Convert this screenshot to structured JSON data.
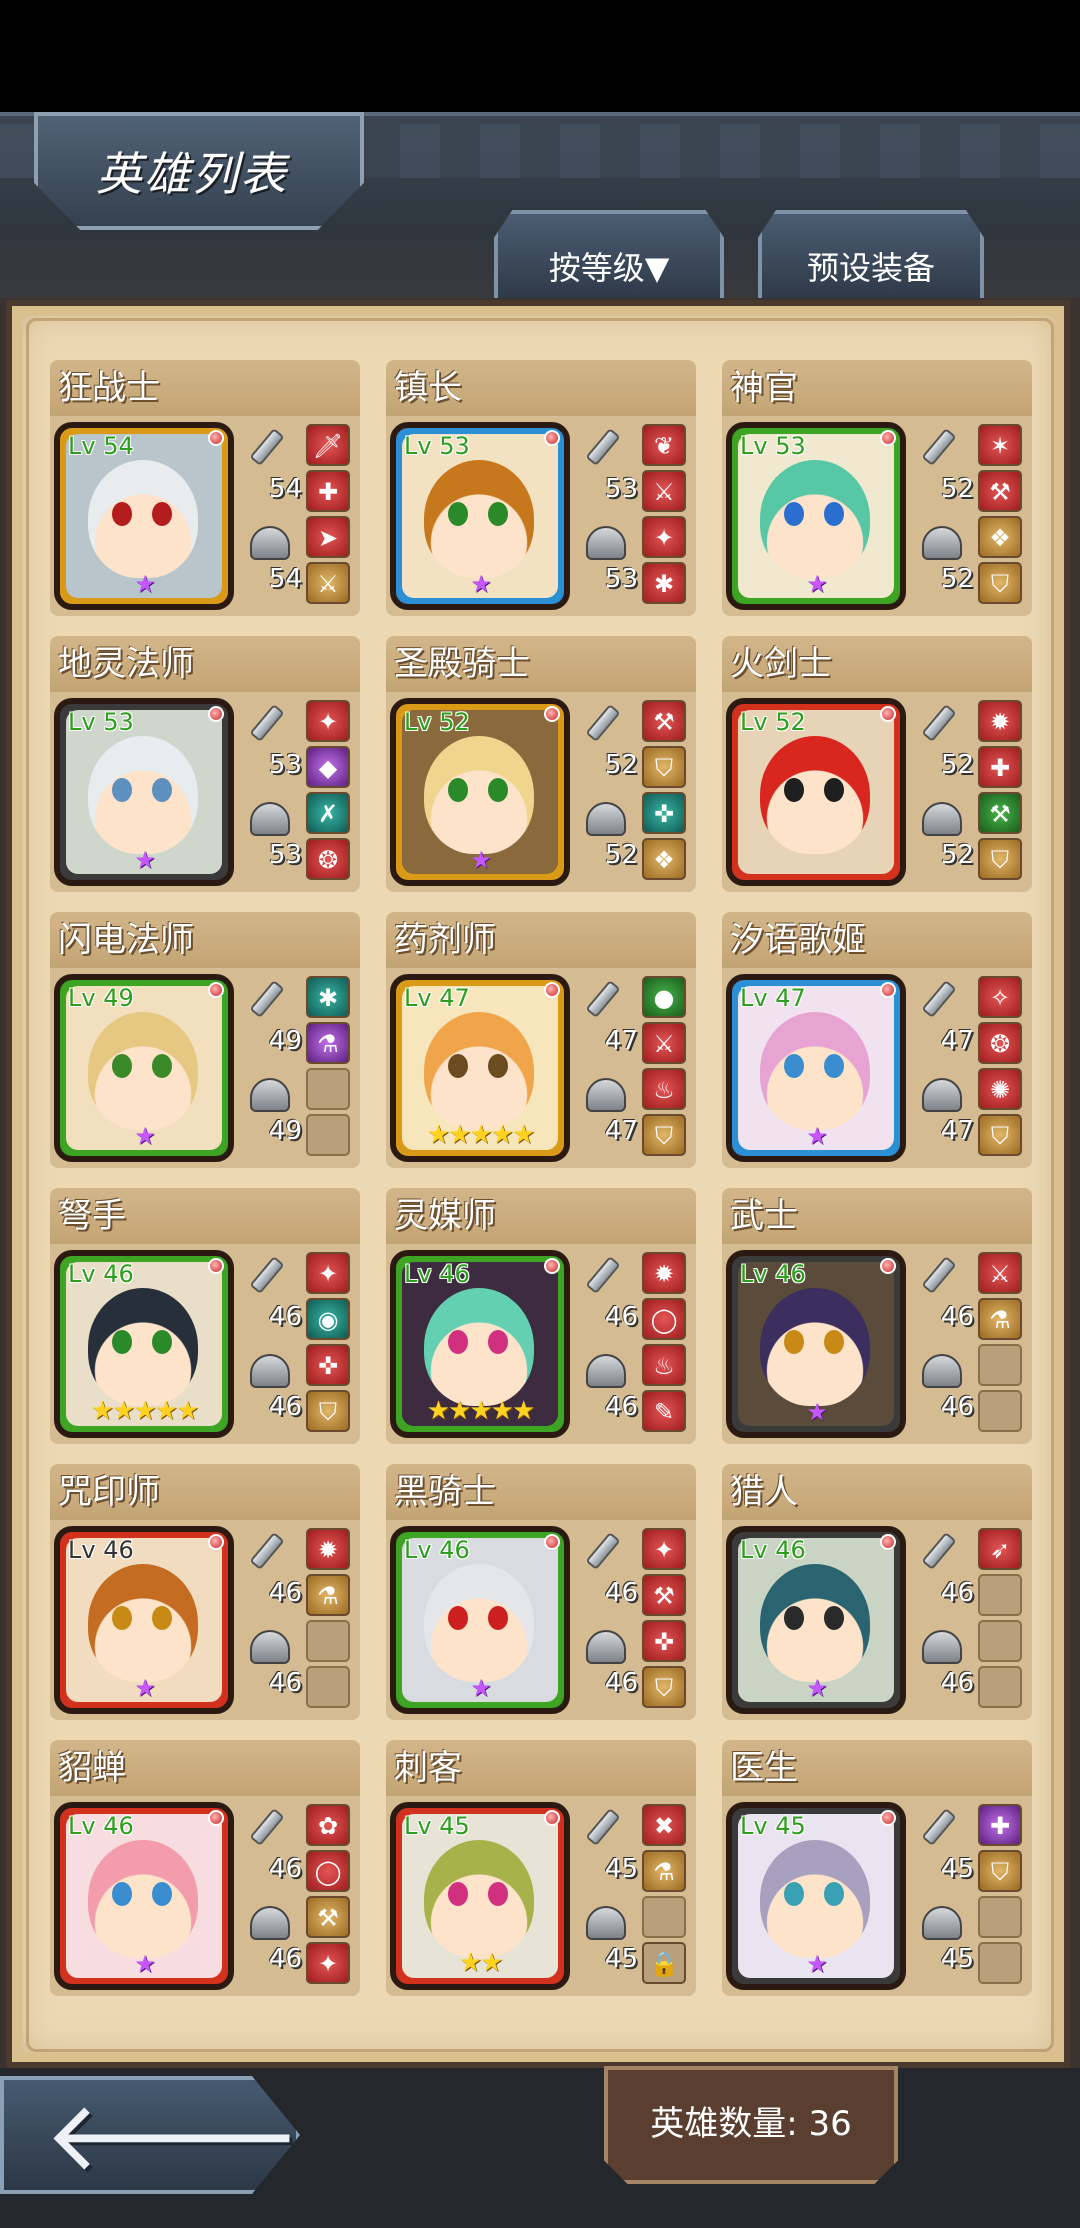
{
  "header": {
    "title": "英雄列表",
    "sort_label": "按等级▼",
    "preset_label": "预设装备"
  },
  "footer": {
    "hero_count_label": "英雄数量: 36"
  },
  "heroes": [
    {
      "name": "狂战士",
      "level": "Lv 54",
      "atk": "54",
      "def": "54",
      "frame": "#d99a17",
      "bg": "#b8c6cc",
      "hair": "#e9ecef",
      "eye": "#b31d1d",
      "stars": "★",
      "star_type": "purple",
      "slots": [
        "red",
        "red",
        "red",
        "gold"
      ],
      "slot_icons": [
        "🗡",
        "✚",
        "➤",
        "⚔"
      ]
    },
    {
      "name": "镇长",
      "level": "Lv 53",
      "atk": "53",
      "def": "53",
      "frame": "#2b8fd6",
      "bg": "#f2e2c2",
      "hair": "#c8781c",
      "eye": "#2a8a2a",
      "stars": "★",
      "star_type": "purple",
      "slots": [
        "red",
        "red",
        "red",
        "red"
      ],
      "slot_icons": [
        "❦",
        "⚔",
        "✦",
        "✱"
      ]
    },
    {
      "name": "神官",
      "level": "Lv 53",
      "atk": "52",
      "def": "52",
      "frame": "#3da424",
      "bg": "#f0e8cf",
      "hair": "#57c7a5",
      "eye": "#2a6fd0",
      "stars": "★",
      "star_type": "purple",
      "slots": [
        "red",
        "red",
        "gold",
        "gold"
      ],
      "slot_icons": [
        "✶",
        "⚒",
        "❖",
        "⛉"
      ]
    },
    {
      "name": "地灵法师",
      "level": "Lv 53",
      "atk": "53",
      "def": "53",
      "frame": "#3a3a3a",
      "bg": "#cfd6cc",
      "hair": "#e7ecef",
      "eye": "#5e90bf",
      "stars": "★",
      "star_type": "purple",
      "slots": [
        "red",
        "purple",
        "teal",
        "red"
      ],
      "slot_icons": [
        "✦",
        "◆",
        "✗",
        "❂"
      ]
    },
    {
      "name": "圣殿骑士",
      "level": "Lv 52",
      "atk": "52",
      "def": "52",
      "frame": "#d99a17",
      "bg": "#8a6a3c",
      "hair": "#f0d58f",
      "eye": "#2a8a2a",
      "stars": "★",
      "star_type": "purple",
      "slots": [
        "red",
        "gold",
        "teal",
        "gold"
      ],
      "slot_icons": [
        "⚒",
        "⛉",
        "✜",
        "❖"
      ]
    },
    {
      "name": "火剑士",
      "level": "Lv 52",
      "atk": "52",
      "def": "52",
      "frame": "#d2321d",
      "bg": "#e7d3b6",
      "hair": "#d9271f",
      "eye": "#1f1f1f",
      "stars": "",
      "star_type": "purple",
      "slots": [
        "red",
        "red",
        "green",
        "gold"
      ],
      "slot_icons": [
        "✹",
        "✚",
        "⚒",
        "⛉"
      ]
    },
    {
      "name": "闪电法师",
      "level": "Lv 49",
      "atk": "49",
      "def": "49",
      "frame": "#3da424",
      "bg": "#f1dfbd",
      "hair": "#e6c883",
      "eye": "#3a8a2a",
      "stars": "★",
      "star_type": "purple",
      "slots": [
        "teal",
        "purple",
        "empty",
        "empty"
      ],
      "slot_icons": [
        "✱",
        "⚗",
        "",
        ""
      ]
    },
    {
      "name": "药剂师",
      "level": "Lv 47",
      "atk": "47",
      "def": "47",
      "frame": "#d99a17",
      "bg": "#f7e5bc",
      "hair": "#f0a54a",
      "eye": "#6b4b20",
      "stars": "★★★★★",
      "star_type": "gold",
      "slots": [
        "green",
        "red",
        "red",
        "gold"
      ],
      "slot_icons": [
        "●",
        "⚔",
        "♨",
        "⛉"
      ]
    },
    {
      "name": "汐语歌姬",
      "level": "Lv 47",
      "atk": "47",
      "def": "47",
      "frame": "#2b8fd6",
      "bg": "#f0e3ef",
      "hair": "#e7a4d2",
      "eye": "#3a8ed0",
      "stars": "★",
      "star_type": "purple",
      "slots": [
        "red",
        "red",
        "red",
        "gold"
      ],
      "slot_icons": [
        "✧",
        "❂",
        "✺",
        "⛉"
      ]
    },
    {
      "name": "弩手",
      "level": "Lv 46",
      "atk": "46",
      "def": "46",
      "frame": "#3da424",
      "bg": "#e9dfc9",
      "hair": "#27303a",
      "eye": "#2a8a2a",
      "stars": "★★★★★",
      "star_type": "gold",
      "slots": [
        "red",
        "teal",
        "red",
        "gold"
      ],
      "slot_icons": [
        "✦",
        "◉",
        "✜",
        "⛉"
      ]
    },
    {
      "name": "灵媒师",
      "level": "Lv 46",
      "atk": "46",
      "def": "46",
      "frame": "#3da424",
      "bg": "#3d2b3f",
      "hair": "#63d1b1",
      "eye": "#d0307d",
      "stars": "★★★★★",
      "star_type": "gold",
      "slots": [
        "red",
        "red",
        "red",
        "red"
      ],
      "slot_icons": [
        "✹",
        "◯",
        "♨",
        "✎"
      ]
    },
    {
      "name": "武士",
      "level": "Lv 46",
      "atk": "46",
      "def": "46",
      "frame": "#3a3a3a",
      "bg": "#5a4b3a",
      "hair": "#3c2e5e",
      "eye": "#c78a14",
      "stars": "★",
      "star_type": "purple",
      "slots": [
        "red",
        "gold",
        "empty",
        "empty"
      ],
      "slot_icons": [
        "⚔",
        "⚗",
        "",
        ""
      ]
    },
    {
      "name": "咒印师",
      "level": "Lv 46",
      "atk": "46",
      "def": "46",
      "frame": "#d2321d",
      "bg": "#f2dcbf",
      "hair": "#c46d22",
      "eye": "#c78a14",
      "stars": "★",
      "star_type": "purple",
      "slots": [
        "red",
        "gold",
        "empty",
        "empty"
      ],
      "slot_icons": [
        "✹",
        "⚗",
        "",
        ""
      ]
    },
    {
      "name": "黑骑士",
      "level": "Lv 46",
      "atk": "46",
      "def": "46",
      "frame": "#3da424",
      "bg": "#d8dbe0",
      "hair": "#e4e6ea",
      "eye": "#cc1f1f",
      "stars": "★",
      "star_type": "purple",
      "slots": [
        "red",
        "red",
        "red",
        "gold"
      ],
      "slot_icons": [
        "✦",
        "⚒",
        "✜",
        "⛉"
      ]
    },
    {
      "name": "猎人",
      "level": "Lv 46",
      "atk": "46",
      "def": "46",
      "frame": "#3a3a3a",
      "bg": "#c9d4c4",
      "hair": "#2a6470",
      "eye": "#2a2a2a",
      "stars": "★",
      "star_type": "purple",
      "slots": [
        "red",
        "empty",
        "empty",
        "empty"
      ],
      "slot_icons": [
        "➶",
        "",
        "",
        ""
      ]
    },
    {
      "name": "貂蝉",
      "level": "Lv 46",
      "atk": "46",
      "def": "46",
      "frame": "#d2321d",
      "bg": "#f7dce0",
      "hair": "#f29cac",
      "eye": "#3a8ed0",
      "stars": "★",
      "star_type": "purple",
      "slots": [
        "red",
        "red",
        "gold",
        "red"
      ],
      "slot_icons": [
        "✿",
        "◯",
        "⚒",
        "✦"
      ]
    },
    {
      "name": "刺客",
      "level": "Lv 45",
      "atk": "45",
      "def": "45",
      "frame": "#d2321d",
      "bg": "#e7e3d6",
      "hair": "#a8b24a",
      "eye": "#d0307d",
      "stars": "★★",
      "star_type": "gold",
      "slots": [
        "red",
        "gold",
        "empty",
        "locked"
      ],
      "slot_icons": [
        "✖",
        "⚗",
        "",
        "🔒"
      ]
    },
    {
      "name": "医生",
      "level": "Lv 45",
      "atk": "45",
      "def": "45",
      "frame": "#3a3a3a",
      "bg": "#e9e4ef",
      "hair": "#a7a0bf",
      "eye": "#3aa0b3",
      "stars": "★",
      "star_type": "purple",
      "slots": [
        "purple",
        "gold",
        "empty",
        "empty"
      ],
      "slot_icons": [
        "✚",
        "⛉",
        "",
        ""
      ]
    }
  ]
}
